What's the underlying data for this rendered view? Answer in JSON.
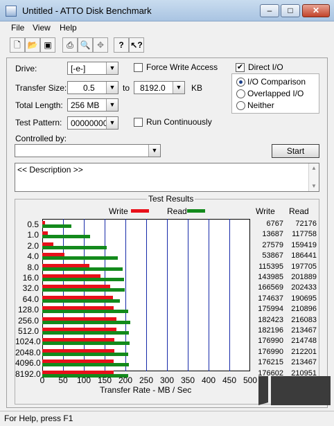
{
  "window": {
    "title": "Untitled - ATTO Disk Benchmark"
  },
  "menu": [
    "File",
    "View",
    "Help"
  ],
  "toolbar_icons": [
    "new-icon",
    "open-icon",
    "save-icon",
    "print-icon",
    "print-preview-icon",
    "move-icon",
    "help-icon",
    "context-help-icon"
  ],
  "form": {
    "drive_label": "Drive:",
    "drive_value": "[-e-]",
    "force_write_label": "Force Write Access",
    "direct_io_label": "Direct I/O",
    "transfer_size_label": "Transfer Size:",
    "transfer_from": "0.5",
    "to_label": "to",
    "transfer_to": "8192.0",
    "kb_label": "KB",
    "total_length_label": "Total Length:",
    "total_length_value": "256 MB",
    "test_pattern_label": "Test Pattern:",
    "test_pattern_value": "00000000",
    "run_continuously_label": "Run Continuously",
    "controlled_by_label": "Controlled by:",
    "controlled_by_value": "",
    "io_comparison_label": "I/O Comparison",
    "overlapped_io_label": "Overlapped I/O",
    "neither_label": "Neither",
    "start_label": "Start",
    "description_text": "<< Description >>"
  },
  "state": {
    "force_write": false,
    "direct_io": true,
    "run_continuously": false,
    "io_mode": "I/O Comparison"
  },
  "results_title": "Test Results",
  "colors": {
    "write": "#e8101a",
    "read": "#138a1c",
    "grid": "#1428a8",
    "watermark": "#3b3b3b"
  },
  "watermark_text": "",
  "status": "For Help, press F1",
  "chart_data": {
    "type": "bar",
    "legend": [
      "Write",
      "Read"
    ],
    "xlabel": "Transfer Rate - MB / Sec",
    "xlim": [
      0,
      500
    ],
    "xticks": [
      "0",
      "50",
      "100",
      "150",
      "200",
      "250",
      "300",
      "350",
      "400",
      "450",
      "500"
    ],
    "categories": [
      "0.5",
      "1.0",
      "2.0",
      "4.0",
      "8.0",
      "16.0",
      "32.0",
      "64.0",
      "128.0",
      "256.0",
      "512.0",
      "1024.0",
      "2048.0",
      "4096.0",
      "8192.0"
    ],
    "columns": [
      "Write",
      "Read"
    ],
    "series": [
      {
        "name": "Write",
        "values": [
          6767,
          13687,
          27579,
          53867,
          115395,
          143985,
          166569,
          174637,
          175994,
          182423,
          182196,
          176990,
          176990,
          176215,
          176602
        ]
      },
      {
        "name": "Read",
        "values": [
          72176,
          117758,
          159419,
          186441,
          197705,
          201889,
          202433,
          190695,
          210896,
          216083,
          213467,
          214748,
          212201,
          213467,
          210951
        ]
      }
    ]
  }
}
